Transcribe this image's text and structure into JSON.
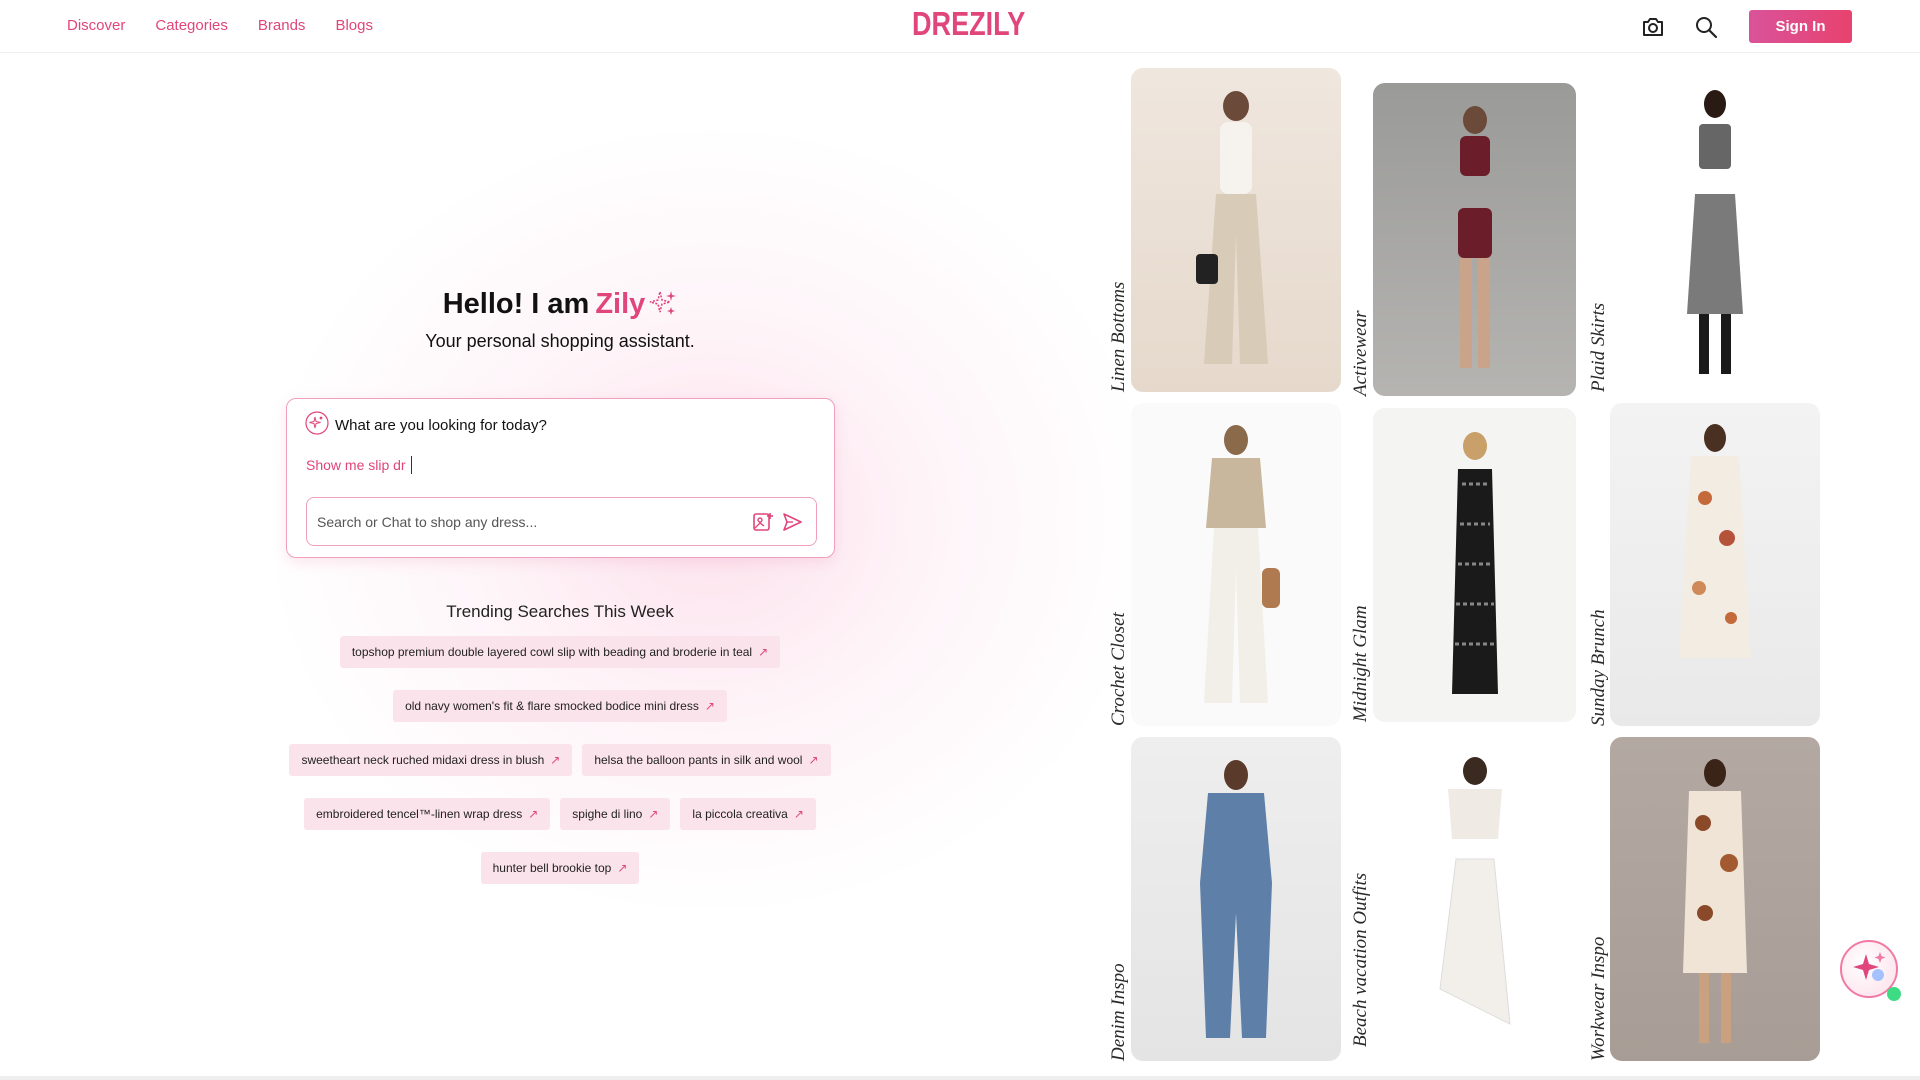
{
  "header": {
    "logo": "DREZILY",
    "nav": [
      "Discover",
      "Categories",
      "Brands",
      "Blogs"
    ],
    "signin_label": "Sign In",
    "icons": [
      "camera-icon",
      "search-icon"
    ]
  },
  "hero": {
    "greeting": "Hello! I am",
    "assistant_name": "Zily",
    "subtitle": "Your personal shopping assistant."
  },
  "chat": {
    "question": "What are you looking for today?",
    "typing_text": "Show me slip dr",
    "input_placeholder": "Search or Chat to shop any dress...",
    "input_value": ""
  },
  "trending": {
    "title": "Trending Searches This Week",
    "chips": [
      "topshop premium double layered cowl slip with beading and broderie in teal",
      "old navy women's fit & flare smocked bodice mini dress",
      "sweetheart neck ruched midaxi dress in blush",
      "helsa the balloon pants in silk and wool",
      "embroidered tencel™-linen wrap dress",
      "spighe di lino",
      "la piccola creativa",
      "hunter bell brookie top"
    ]
  },
  "collections": [
    {
      "label": "Linen Bottoms"
    },
    {
      "label": "Activewear"
    },
    {
      "label": "Plaid Skirts"
    },
    {
      "label": "Crochet Closet"
    },
    {
      "label": "Midnight Glam"
    },
    {
      "label": "Sunday Brunch"
    },
    {
      "label": "Denim Inspo"
    },
    {
      "label": "Beach vacation Outfits"
    },
    {
      "label": "Workwear Inspo"
    }
  ],
  "colors": {
    "accent": "#e0457b",
    "chip_bg": "#fbe3ec",
    "signin_gradient_start": "#d9539a",
    "signin_gradient_end": "#e8426e"
  }
}
